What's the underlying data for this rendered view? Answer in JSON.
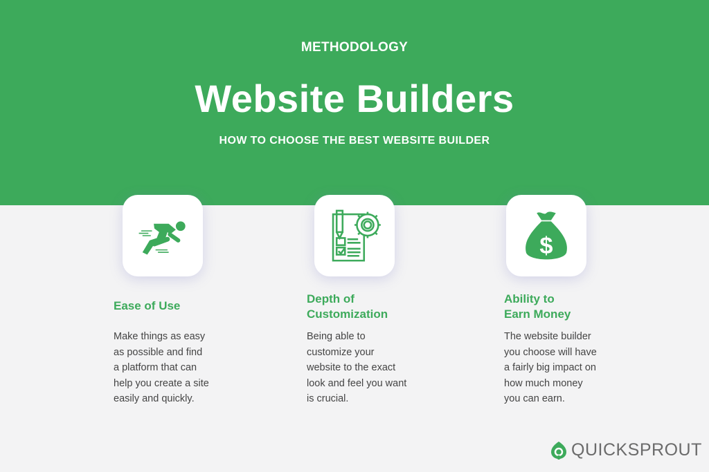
{
  "header": {
    "eyebrow": "METHODOLOGY",
    "title": "Website Builders",
    "subtitle": "HOW TO CHOOSE THE BEST WEBSITE BUILDER"
  },
  "features": [
    {
      "icon": "sprinting-runner-icon",
      "title_lines": [
        "Ease of Use"
      ],
      "description_lines": [
        "Make things as easy",
        "as possible and find",
        "a platform that can",
        "help you create a site",
        "easily and quickly."
      ]
    },
    {
      "icon": "document-gear-pencil-icon",
      "title_lines": [
        "Depth of",
        "Customization"
      ],
      "description_lines": [
        "Being able to",
        "customize your",
        "website to the exact",
        "look and feel you want",
        "is crucial."
      ]
    },
    {
      "icon": "money-bag-icon",
      "title_lines": [
        "Ability to",
        "Earn Money"
      ],
      "description_lines": [
        "The website builder",
        "you choose will have",
        "a fairly big impact on",
        "how much money",
        "you can earn."
      ]
    }
  ],
  "brand": {
    "name": "QUICKSPROUT",
    "logo_icon": "sprout-leaf-icon"
  },
  "colors": {
    "accent": "#3daa5b",
    "background": "#f3f3f4",
    "body_text": "#444444",
    "logo_text": "#6b6b6b"
  }
}
